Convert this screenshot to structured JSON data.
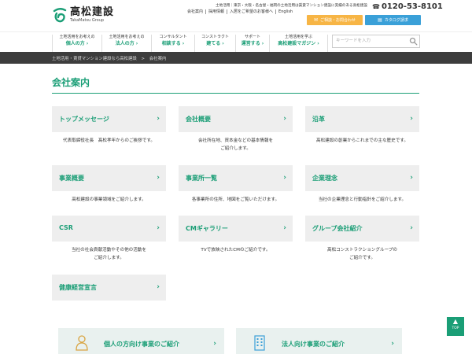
{
  "header": {
    "logo_jp": "高松建設",
    "logo_en": "TakaMatsu Group",
    "tagline": "土地活用｜東京・大阪・名古屋・福岡の土地活用は賃貸マンション建設に実績のある高松建設",
    "phone": "0120-53-8101",
    "util_links": [
      "会社案内",
      "採用情報",
      "入居をご希望のお客様へ",
      "English"
    ],
    "contact_label": "ご相談・お問合わせ",
    "catalog_label": "カタログ請求"
  },
  "gnav": {
    "items": [
      {
        "sub": "土地活用をお考えの",
        "main": "個人の方"
      },
      {
        "sub": "土地活用をお考えの",
        "main": "法人の方"
      },
      {
        "sub": "コンサルタント",
        "main": "相談する"
      },
      {
        "sub": "コンストラクト",
        "main": "建てる"
      },
      {
        "sub": "サポート",
        "main": "運営する"
      },
      {
        "sub": "土地活用を学ぶ",
        "main": "高松建設マガジン"
      }
    ],
    "search_placeholder": "キーワードを入力"
  },
  "breadcrumb": {
    "items": [
      "土地活用・賃貸マンション建設なら高松建設",
      "会社案内"
    ],
    "separator": ">"
  },
  "page_title": "会社案内",
  "cards": [
    {
      "label": "トップメッセージ",
      "desc": "代表取締役社長　髙松孝年からのご挨拶です。"
    },
    {
      "label": "会社概要",
      "desc": "会社所在地、資本金などの基本情報を\nご紹介します。"
    },
    {
      "label": "沿革",
      "desc": "髙松建設の創業からこれまでの主な歴史です。"
    },
    {
      "label": "事業概要",
      "desc": "髙松建設の事業領域をご紹介します。"
    },
    {
      "label": "事業所一覧",
      "desc": "各事業所の住所、地図をご覧いただけます。"
    },
    {
      "label": "企業理念",
      "desc": "当社の企業理念と行動指針をご紹介します。"
    },
    {
      "label": "CSR",
      "desc": "当社の社会貢献活動やその他の活動を\nご紹介します。"
    },
    {
      "label": "CMギャラリー",
      "desc": "TVで放映されたCMのご紹介です。"
    },
    {
      "label": "グループ会社紹介",
      "desc": "髙松コンストラクショングループの\nご紹介です。"
    },
    {
      "label": "健康経営宣言",
      "desc": ""
    }
  ],
  "banners": [
    {
      "label": "個人の方向け事業のご紹介",
      "icon": "person-icon"
    },
    {
      "label": "法人向け事業のご紹介",
      "icon": "building-icon"
    }
  ],
  "totop_label": "TOP",
  "arrow": "›",
  "colors": {
    "accent": "#1a9e76",
    "contact": "#f7b545",
    "catalog": "#3aa0d8",
    "breadcrumb_bg": "#3d3d3d"
  }
}
